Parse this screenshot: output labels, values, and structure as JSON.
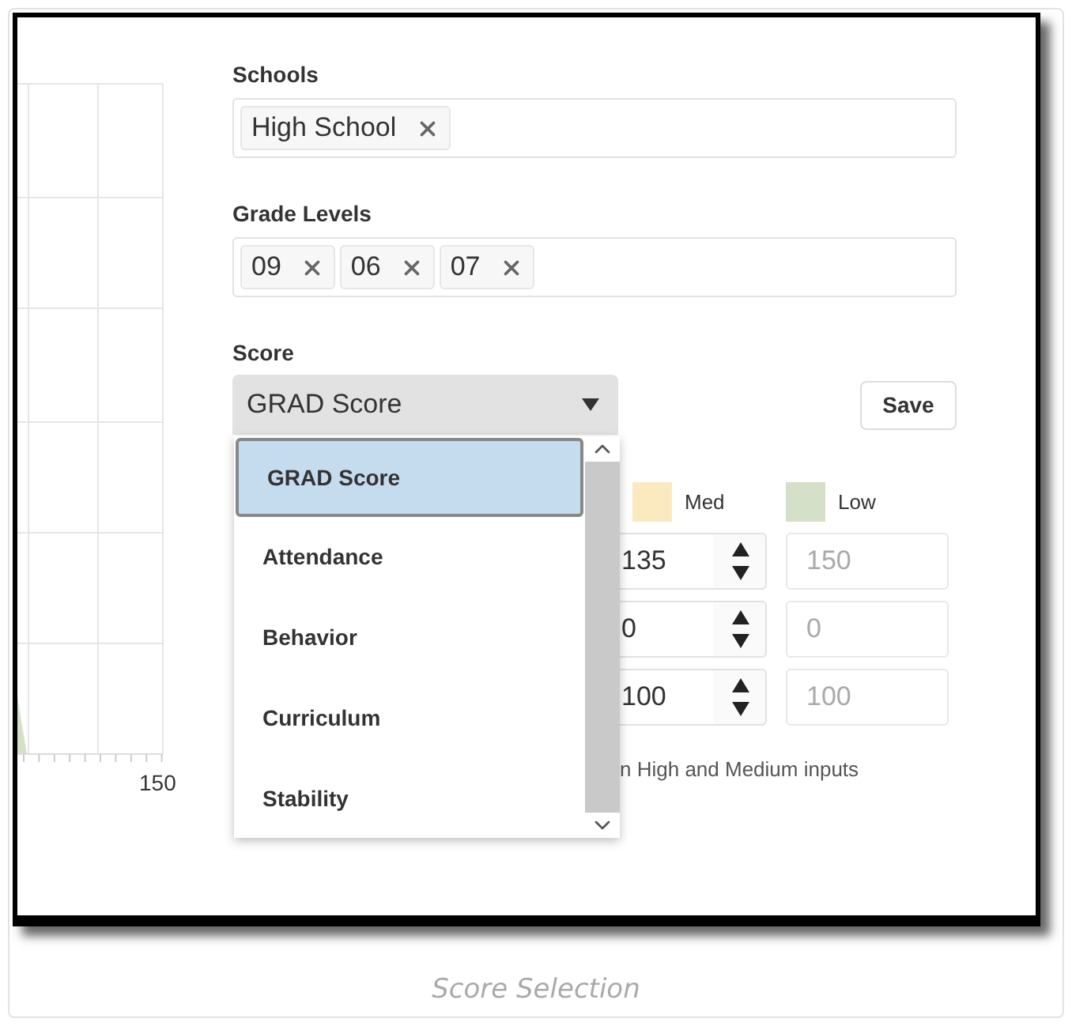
{
  "schools": {
    "label": "Schools",
    "tags": [
      "High School"
    ]
  },
  "grade_levels": {
    "label": "Grade Levels",
    "tags": [
      "09",
      "06",
      "07"
    ]
  },
  "score": {
    "label": "Score",
    "value": "GRAD Score",
    "expanded": true,
    "options": [
      {
        "label": "GRAD Score",
        "selected": true
      },
      {
        "label": "Attendance",
        "selected": false
      },
      {
        "label": "Behavior",
        "selected": false
      },
      {
        "label": "Curriculum",
        "selected": false
      },
      {
        "label": "Stability",
        "selected": false
      }
    ]
  },
  "save_button": "Save",
  "legend": [
    {
      "label": "Med",
      "color": "#fbe9c0"
    },
    {
      "label": "Low",
      "color": "#d5e0c8"
    }
  ],
  "thresholds": [
    {
      "med": "135",
      "low": "150"
    },
    {
      "med": "0",
      "low": "0"
    },
    {
      "med": "100",
      "low": "100"
    }
  ],
  "note": "n High and Medium inputs",
  "chart": {
    "axis_label": "150"
  },
  "caption": "Score Selection"
}
